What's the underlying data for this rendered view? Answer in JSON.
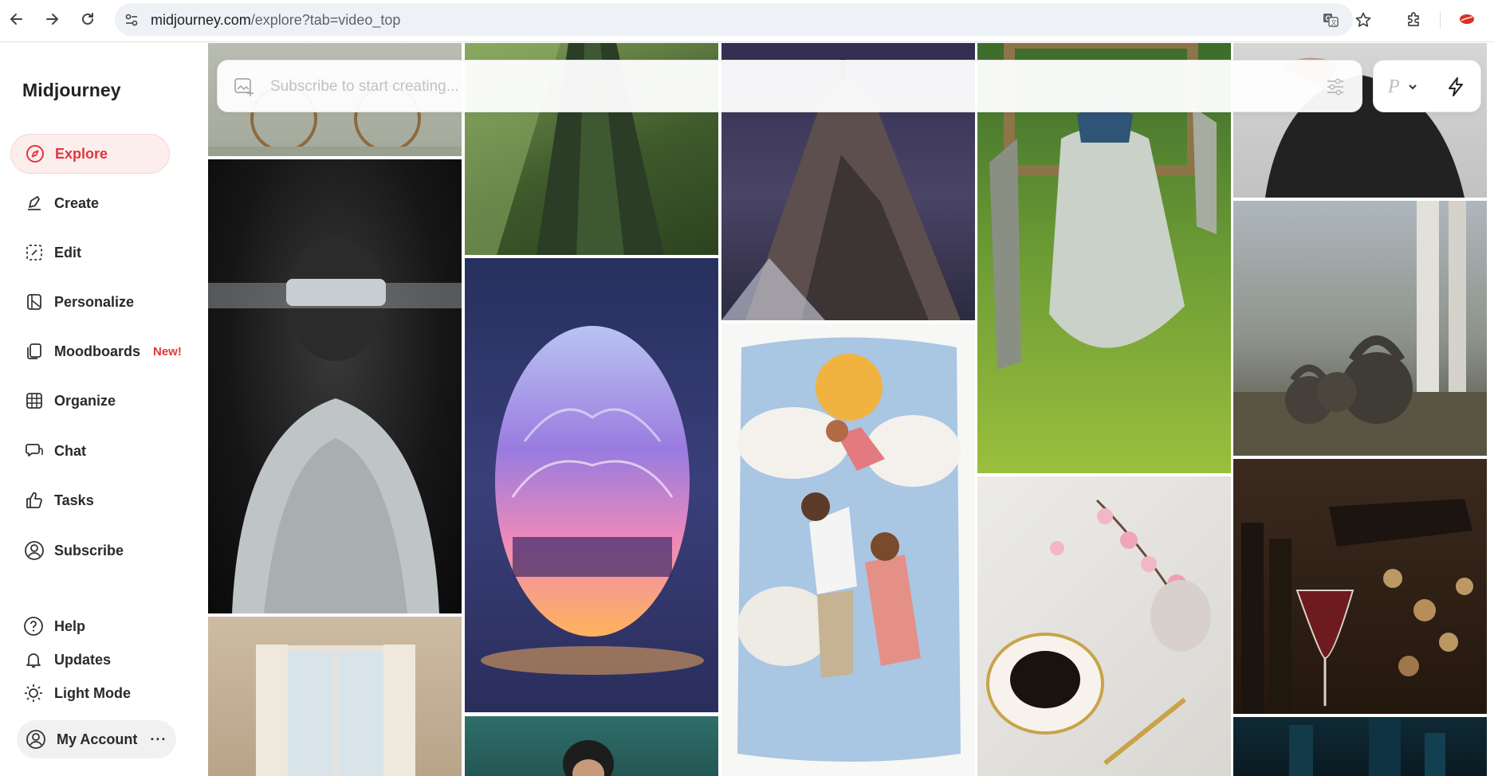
{
  "browser": {
    "url_host": "midjourney.com",
    "url_path": "/explore?tab=video_top"
  },
  "sidebar": {
    "brand": "Midjourney",
    "nav": [
      {
        "label": "Explore",
        "icon": "compass-icon",
        "active": true
      },
      {
        "label": "Create",
        "icon": "brush-icon"
      },
      {
        "label": "Edit",
        "icon": "edit-icon"
      },
      {
        "label": "Personalize",
        "icon": "personalize-icon"
      },
      {
        "label": "Moodboards",
        "icon": "moodboards-icon",
        "badge": "New!"
      },
      {
        "label": "Organize",
        "icon": "grid-icon"
      },
      {
        "label": "Chat",
        "icon": "chat-icon"
      },
      {
        "label": "Tasks",
        "icon": "thumbs-up-icon"
      },
      {
        "label": "Subscribe",
        "icon": "user-circle-icon"
      }
    ],
    "bottom": [
      {
        "label": "Help",
        "icon": "help-icon"
      },
      {
        "label": "Updates",
        "icon": "bell-icon"
      },
      {
        "label": "Light Mode",
        "icon": "sun-icon"
      }
    ],
    "account": {
      "label": "My Account",
      "more": "···",
      "icon": "account-icon"
    }
  },
  "prompt": {
    "placeholder": "Subscribe to start creating...",
    "mode_letter": "P"
  },
  "colors": {
    "accent": "#e2353c",
    "active_bg": "#fdeeee"
  }
}
